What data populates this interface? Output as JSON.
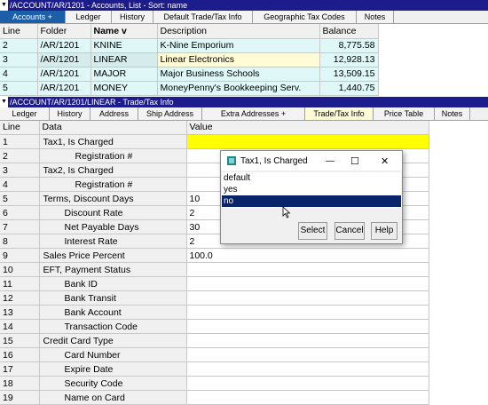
{
  "top_pane": {
    "title": "/ACCOUNT/AR/1201 - Accounts, List - Sort: name",
    "tabs": [
      "Accounts   +",
      "Ledger",
      "History",
      "Default Trade/Tax Info",
      "Geographic Tax Codes",
      "Notes"
    ],
    "columns": [
      "Line",
      "Folder",
      "Name  v",
      "Description",
      "Balance"
    ],
    "rows": [
      {
        "line": "2",
        "folder": "/AR/1201",
        "name": "KNINE",
        "description": "K-Nine Emporium",
        "balance": "8,775.58"
      },
      {
        "line": "3",
        "folder": "/AR/1201",
        "name": "LINEAR",
        "description": "Linear Electronics",
        "balance": "12,928.13"
      },
      {
        "line": "4",
        "folder": "/AR/1201",
        "name": "MAJOR",
        "description": "Major Business Schools",
        "balance": "13,509.15"
      },
      {
        "line": "5",
        "folder": "/AR/1201",
        "name": "MONEY",
        "description": "MoneyPenny's Bookkeeping Serv.",
        "balance": "1,440.75"
      }
    ]
  },
  "bottom_pane": {
    "title": "/ACCOUNT/AR/1201/LINEAR - Trade/Tax Info",
    "tabs": [
      "Ledger",
      "History",
      "Address",
      "Ship Address",
      "Extra Addresses   +",
      "Trade/Tax Info",
      "Price Table",
      "Notes"
    ],
    "columns": [
      "Line",
      "Data",
      "Value"
    ],
    "rows": [
      {
        "line": "1",
        "data": "Tax1, Is Charged",
        "value": "",
        "indent": 0
      },
      {
        "line": "2",
        "data": "Registration #",
        "value": "",
        "indent": 2
      },
      {
        "line": "3",
        "data": "Tax2, Is Charged",
        "value": "",
        "indent": 0
      },
      {
        "line": "4",
        "data": "Registration #",
        "value": "",
        "indent": 2
      },
      {
        "line": "5",
        "data": "Terms, Discount Days",
        "value": "10",
        "indent": 0
      },
      {
        "line": "6",
        "data": "Discount Rate",
        "value": "2",
        "indent": 1
      },
      {
        "line": "7",
        "data": "Net Payable Days",
        "value": "30",
        "indent": 1
      },
      {
        "line": "8",
        "data": "Interest Rate",
        "value": "2",
        "indent": 1
      },
      {
        "line": "9",
        "data": "Sales Price Percent",
        "value": "100.0",
        "indent": 0
      },
      {
        "line": "10",
        "data": "EFT, Payment Status",
        "value": "",
        "indent": 0
      },
      {
        "line": "11",
        "data": "Bank ID",
        "value": "",
        "indent": 1
      },
      {
        "line": "12",
        "data": "Bank Transit",
        "value": "",
        "indent": 1
      },
      {
        "line": "13",
        "data": "Bank Account",
        "value": "",
        "indent": 1
      },
      {
        "line": "14",
        "data": "Transaction Code",
        "value": "",
        "indent": 1
      },
      {
        "line": "15",
        "data": "Credit Card Type",
        "value": "",
        "indent": 0
      },
      {
        "line": "16",
        "data": "Card Number",
        "value": "",
        "indent": 1
      },
      {
        "line": "17",
        "data": "Expire Date",
        "value": "",
        "indent": 1
      },
      {
        "line": "18",
        "data": "Security Code",
        "value": "",
        "indent": 1
      },
      {
        "line": "19",
        "data": "Name on Card",
        "value": "",
        "indent": 1
      }
    ]
  },
  "dialog": {
    "title": "Tax1, Is Charged",
    "minimize": "—",
    "maximize": "☐",
    "close": "✕",
    "options": [
      "default",
      "yes",
      "no"
    ],
    "selected": "no",
    "buttons": {
      "select": "Select",
      "cancel": "Cancel",
      "help": "Help"
    }
  },
  "icons": {
    "dropdown": "▼"
  },
  "colors": {
    "title_bar": "#1c1c8c",
    "active_tab": "#1c5fa8",
    "highlight_yellow": "#ffff00",
    "selection": "#0a246a"
  }
}
